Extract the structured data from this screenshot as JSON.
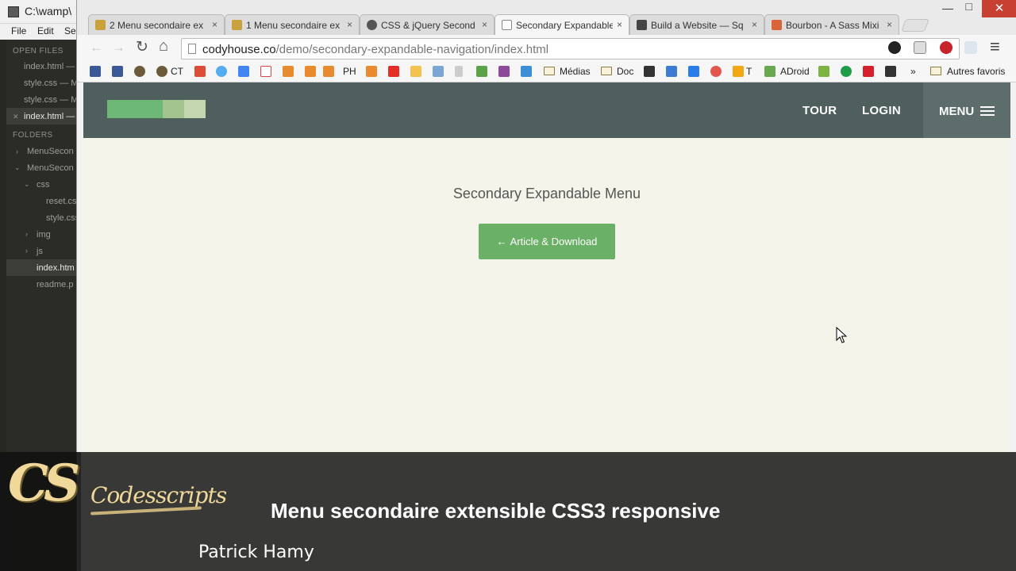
{
  "editor": {
    "title": "C:\\wamp\\",
    "menu": [
      "File",
      "Edit",
      "Sel"
    ],
    "sidebar": {
      "open_files_header": "OPEN FILES",
      "open_files": [
        "index.html —",
        "style.css — M",
        "style.css — M",
        "index.html —"
      ],
      "folders_header": "FOLDERS",
      "folders": [
        {
          "label": "MenuSecon",
          "caret": "›"
        },
        {
          "label": "MenuSecon",
          "caret": "⌄"
        },
        {
          "label": "css",
          "caret": "⌄"
        },
        {
          "label": "reset.cs",
          "caret": ""
        },
        {
          "label": "style.css",
          "caret": ""
        },
        {
          "label": "img",
          "caret": "›"
        },
        {
          "label": "js",
          "caret": "›"
        },
        {
          "label": "index.htm",
          "caret": ""
        },
        {
          "label": "readme.p",
          "caret": ""
        }
      ]
    }
  },
  "browser": {
    "tabs": [
      {
        "label": "2 Menu secondaire ex",
        "favicon_color": "#c9a23d",
        "active": false
      },
      {
        "label": "1 Menu secondaire ex",
        "favicon_color": "#c9a23d",
        "active": false
      },
      {
        "label": "CSS & jQuery Second",
        "favicon_color": "#555555",
        "active": false
      },
      {
        "label": "Secondary Expandable",
        "favicon_color": "#ffffff",
        "active": true
      },
      {
        "label": "Build a Website — Sq",
        "favicon_color": "#444444",
        "active": false
      },
      {
        "label": "Bourbon - A Sass Mixi",
        "favicon_color": "#d9643a",
        "active": false
      }
    ],
    "tab_close": "×",
    "window": {
      "minimize": "—",
      "maximize": "□",
      "close": "✕"
    },
    "nav": {
      "back": "←",
      "forward": "→",
      "reload": "↻",
      "home": "⌂"
    },
    "url_host": "codyhouse.co",
    "url_path": "/demo/secondary-expandable-navigation/index.html",
    "bookmark_star": "☆",
    "bookmarks": {
      "ct": "CT",
      "ph": "PH",
      "medias": "Médias",
      "doc": "Doc",
      "t": "T",
      "adroid": "ADroid",
      "more": "»",
      "other": "Autres favoris"
    },
    "menu_icon": "≡"
  },
  "site": {
    "nav_tour": "TOUR",
    "nav_login": "LOGIN",
    "menu_label": "MENU",
    "title": "Secondary Expandable Menu",
    "cta_arrow": "←",
    "cta_label": "Article & Download",
    "colors": {
      "header": "#4f5f5e",
      "menu_bg": "#5c6d6c",
      "page_bg": "#f4f4ea",
      "cta": "#6ab067"
    }
  },
  "overlay": {
    "brand_mark": "CS",
    "brand_name": "Codesscripts",
    "title": "Menu secondaire extensible CSS3 responsive",
    "author": "Patrick Hamy"
  }
}
